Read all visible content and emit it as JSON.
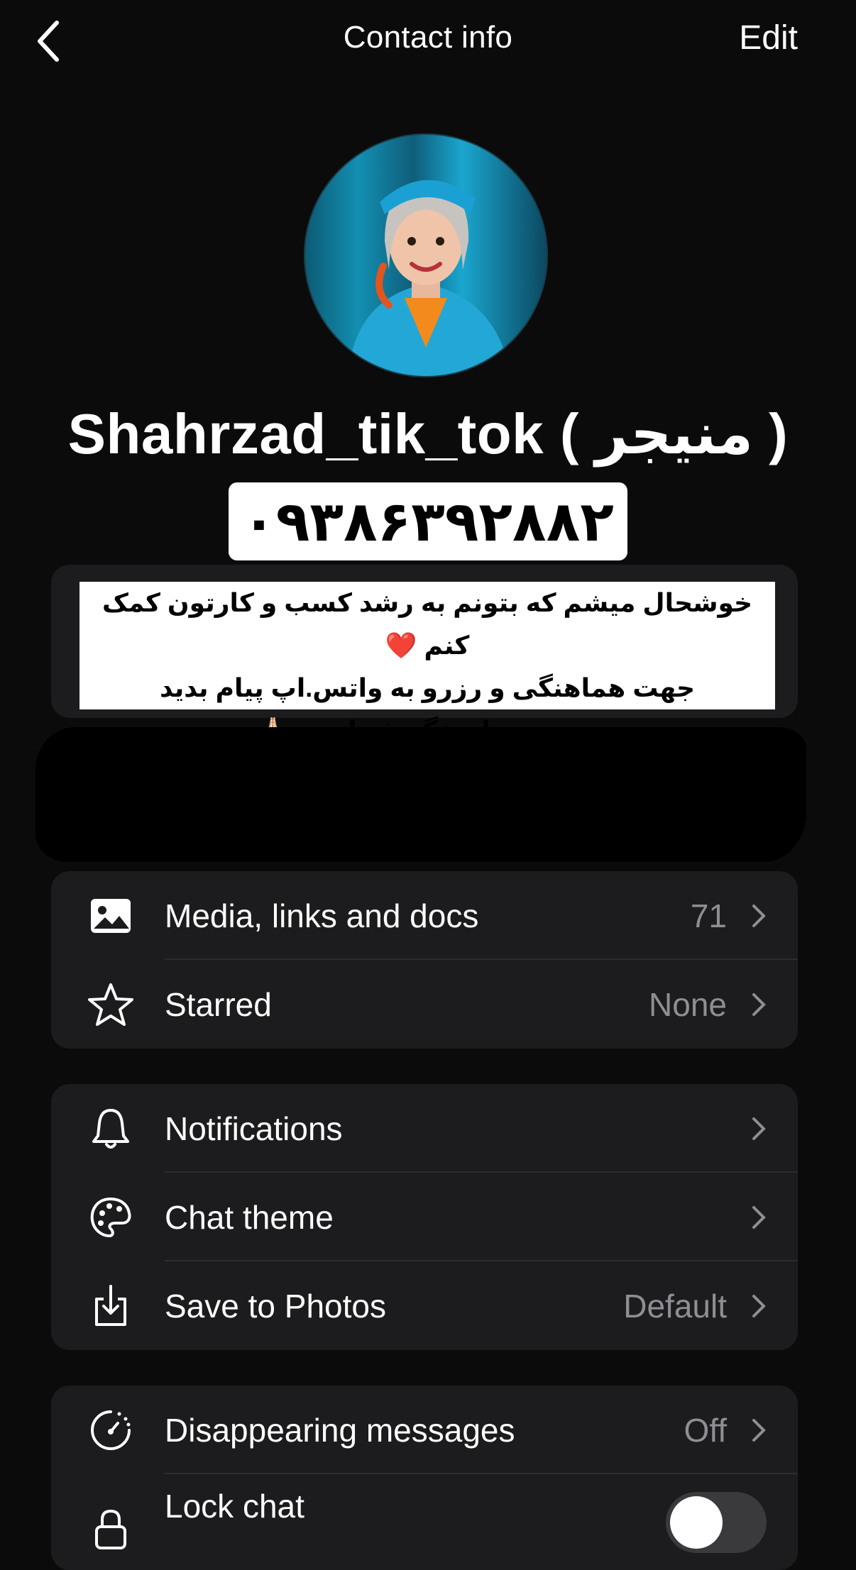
{
  "header": {
    "title": "Contact info",
    "edit_label": "Edit"
  },
  "profile": {
    "name": "Shahrzad_tik_tok ( منیجر )",
    "phone_banner": "۰۹۳۸۶۳۹۲۸۸۲",
    "about_lines": [
      "خوشحال میشم که بتونم به رشد کسب و کارتون کمک کنم ❤️",
      "جهت هماهنگی و رزرو به واتس.اپ پیام بدید",
      "منیجرم پاسخگو شماست 🙏🏻"
    ]
  },
  "section_media": {
    "media_label": "Media, links and docs",
    "media_count": "71",
    "starred_label": "Starred",
    "starred_value": "None"
  },
  "section_settings": {
    "notifications_label": "Notifications",
    "chat_theme_label": "Chat theme",
    "save_photos_label": "Save to Photos",
    "save_photos_value": "Default"
  },
  "section_privacy": {
    "disappearing_label": "Disappearing messages",
    "disappearing_value": "Off",
    "lock_chat_label": "Lock chat",
    "lock_chat_enabled": false
  },
  "icons": [
    "back-chevron-icon",
    "photo-icon",
    "star-icon",
    "bell-icon",
    "palette-icon",
    "download-icon",
    "timer-icon",
    "lock-icon",
    "chevron-right-icon"
  ]
}
